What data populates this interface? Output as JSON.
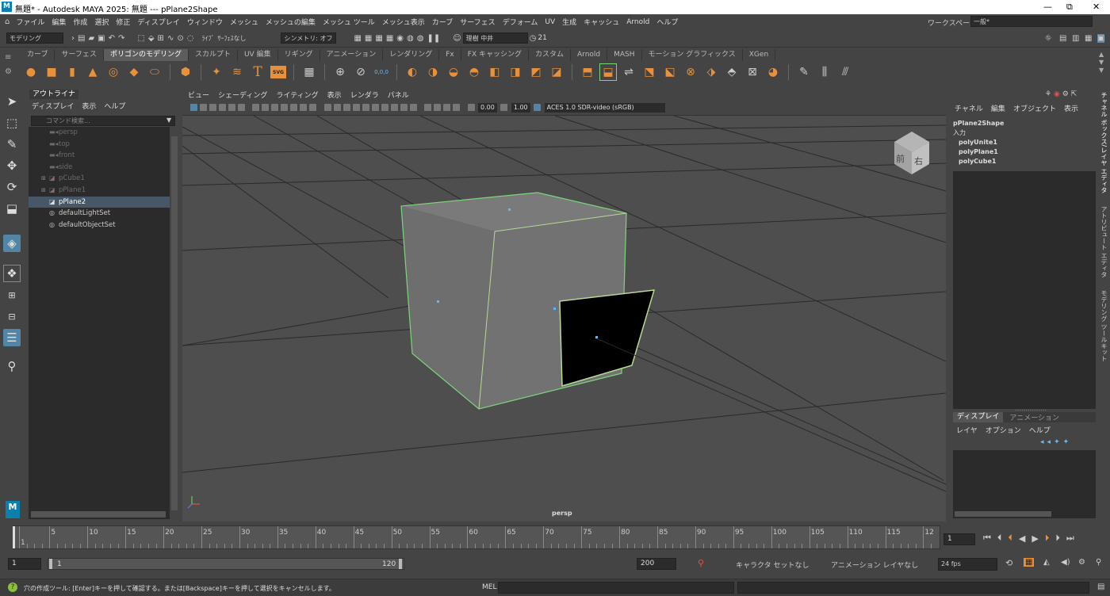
{
  "titlebar": {
    "title": "無題* - Autodesk MAYA 2025: 無題   ---   pPlane2Shape",
    "app_icon_letter": "M",
    "minimize": "—",
    "maximize": "⧉",
    "close": "✕"
  },
  "menubar": {
    "items": [
      "ファイル",
      "編集",
      "作成",
      "選択",
      "修正",
      "ディスプレイ",
      "ウィンドウ",
      "メッシュ",
      "メッシュの編集",
      "メッシュ ツール",
      "メッシュ表示",
      "カーブ",
      "サーフェス",
      "デフォーム",
      "UV",
      "生成",
      "キャッシュ",
      "Arnold",
      "ヘルプ"
    ],
    "workspace_label": "ワークスペース:",
    "workspace_value": "一般*"
  },
  "statusline": {
    "menuset": "モデリング",
    "live_label": "ﾗｲﾌﾞ",
    "live_value": "ｻｰﾌｪｽなし",
    "symmetry": "シンメトリ: オフ",
    "user": "理樹 中井",
    "credits": "21"
  },
  "shelf": {
    "tabs": [
      "カーブ",
      "サーフェス",
      "ポリゴンのモデリング",
      "スカルプト",
      "UV 編集",
      "リギング",
      "アニメーション",
      "レンダリング",
      "Fx",
      "FX キャッシング",
      "カスタム",
      "Arnold",
      "MASH",
      "モーション グラフィックス",
      "XGen"
    ],
    "active_tab": "ポリゴンのモデリング",
    "text_icon": "T",
    "svg_icon": "SVG",
    "zero_label": "0,0,0"
  },
  "outliner": {
    "title": "アウトライナ",
    "menus": [
      "ディスプレイ",
      "表示",
      "ヘルプ"
    ],
    "search_placeholder": "コマンド検索...",
    "items": [
      {
        "label": "persp",
        "dim": true,
        "icon": "camera-icon"
      },
      {
        "label": "top",
        "dim": true,
        "icon": "camera-icon"
      },
      {
        "label": "front",
        "dim": true,
        "icon": "camera-icon"
      },
      {
        "label": "side",
        "dim": true,
        "icon": "camera-icon"
      },
      {
        "label": "pCube1",
        "dim": true,
        "icon": "mesh-icon",
        "expand": true
      },
      {
        "label": "pPlane1",
        "dim": true,
        "icon": "mesh-icon",
        "expand": true
      },
      {
        "label": "pPlane2",
        "dim": false,
        "icon": "mesh-icon",
        "selected": true
      },
      {
        "label": "defaultLightSet",
        "dim": false,
        "icon": "set-icon"
      },
      {
        "label": "defaultObjectSet",
        "dim": false,
        "icon": "set-icon"
      }
    ]
  },
  "viewport": {
    "menus": [
      "ビュー",
      "シェーディング",
      "ライティング",
      "表示",
      "レンダラ",
      "パネル"
    ],
    "exposure": "0.00",
    "gamma": "1.00",
    "colorspace": "ACES 1.0 SDR-video (sRGB)",
    "camera_label": "persp",
    "viewcube_front": "前",
    "viewcube_right": "右"
  },
  "channelbox": {
    "menus": [
      "チャネル",
      "編集",
      "オブジェクト",
      "表示"
    ],
    "shape": "pPlane2Shape",
    "inputs_label": "入力",
    "inputs": [
      "polyUnite1",
      "polyPlane1",
      "polyCube1"
    ],
    "layer_tabs": [
      "ディスプレイ",
      "アニメーション"
    ],
    "layer_menus": [
      "レイヤ",
      "オプション",
      "ヘルプ"
    ]
  },
  "side_tabs": [
    "チャネル ボックス/レイヤ エディタ",
    "アトリビュート エディタ",
    "モデリング ツールキット"
  ],
  "timeline": {
    "labels": [
      "1",
      "5",
      "10",
      "15",
      "20",
      "25",
      "30",
      "35",
      "40",
      "45",
      "50",
      "55",
      "60",
      "65",
      "70",
      "75",
      "80",
      "85",
      "90",
      "95",
      "100",
      "105",
      "110",
      "115",
      "12"
    ],
    "current_frame": "1"
  },
  "range": {
    "start": "1",
    "inner_start": "1",
    "inner_end": "120",
    "end": "200",
    "character_set": "キャラクタ セットなし",
    "anim_layer": "アニメーション レイヤなし",
    "fps": "24 fps"
  },
  "helpline": {
    "message": "穴の作成ツール: [Enter]キーを押して確認する。または[Backspace]キーを押して選択をキャンセルします。",
    "mel_label": "MEL"
  },
  "colors": {
    "selection_green": "#7bd67b",
    "accent_blue": "#5285a6",
    "shelf_orange": "#e8913a"
  }
}
